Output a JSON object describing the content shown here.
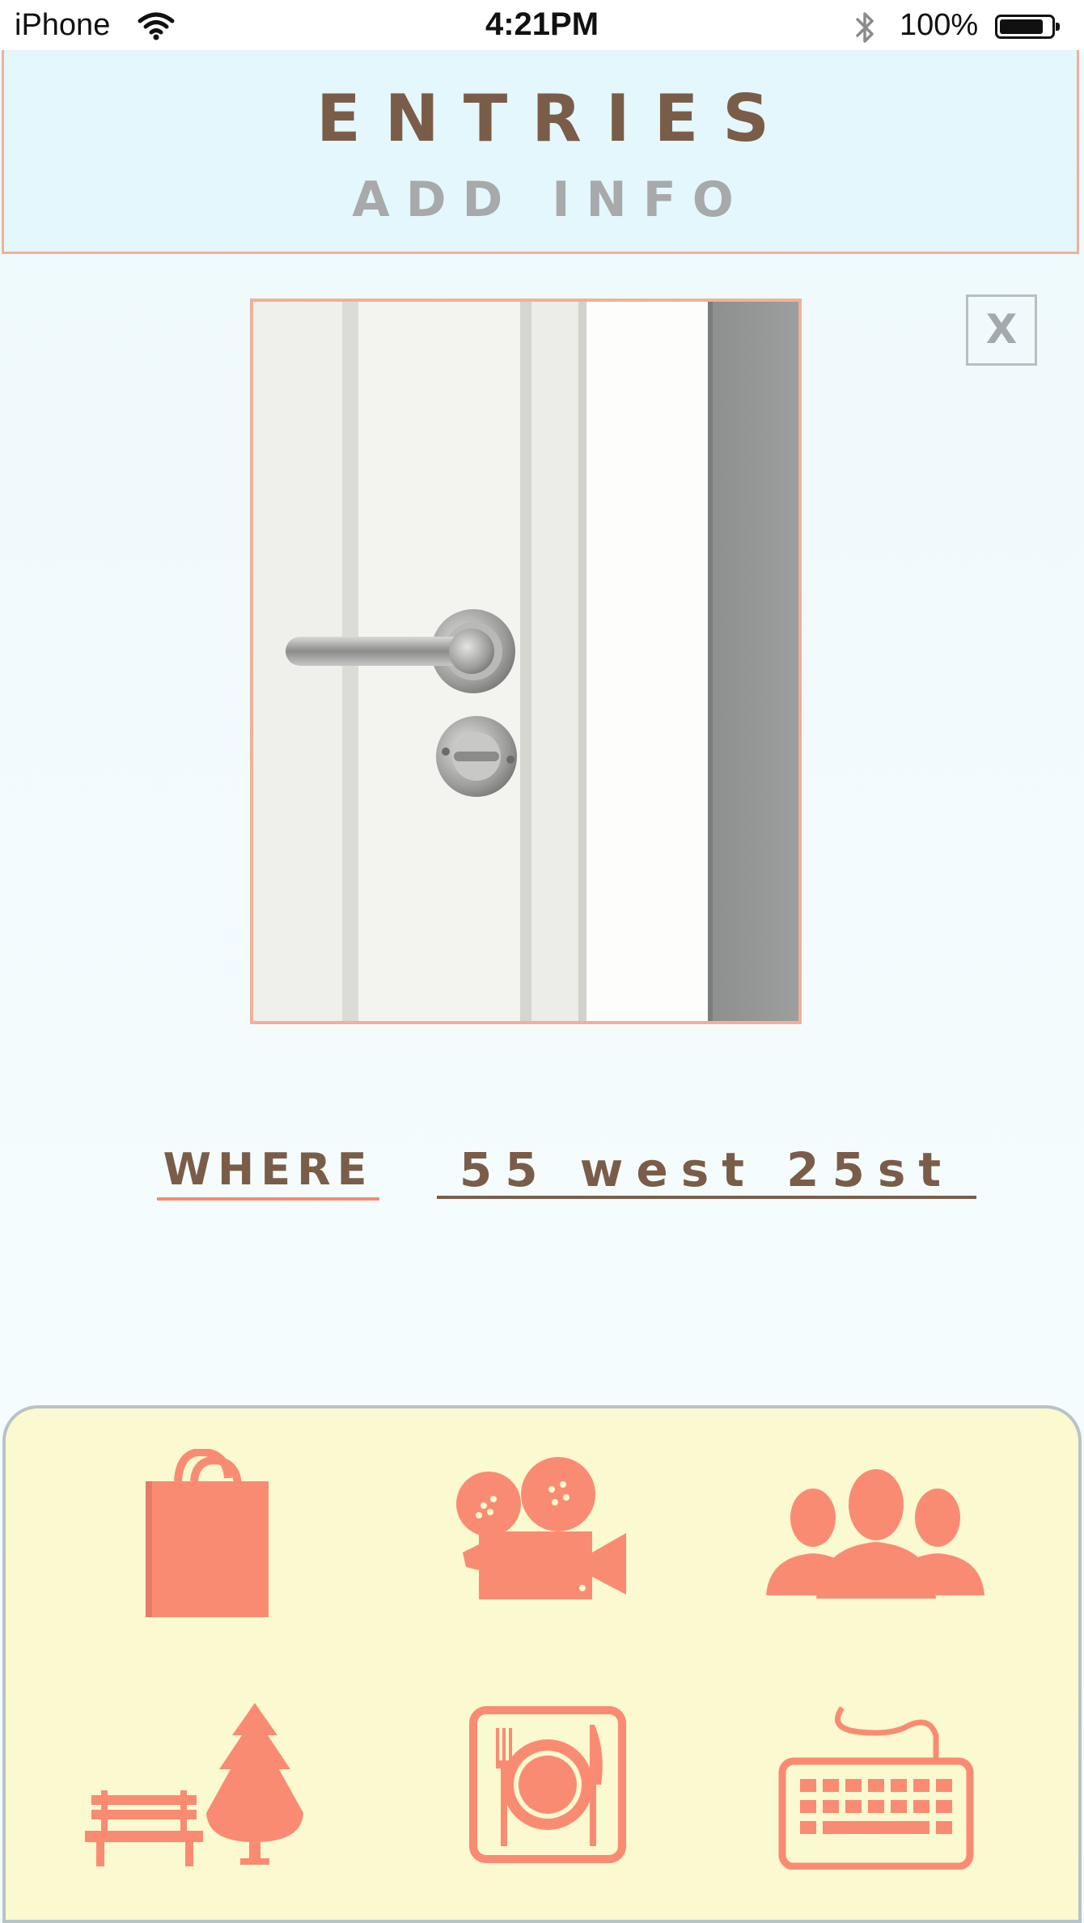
{
  "status_bar": {
    "carrier": "iPhone",
    "time": "4:21PM",
    "battery_percent_label": "100%",
    "battery_level": 0.85,
    "icons": [
      "wifi-icon",
      "bluetooth-icon",
      "battery-icon"
    ]
  },
  "header": {
    "title": "ENTRIES",
    "subtitle": "ADD INFO"
  },
  "close_button": {
    "label": "X"
  },
  "photo": {
    "subject": "door-handle-photo"
  },
  "where": {
    "label": "WHERE",
    "value": "55 west 25st"
  },
  "categories": [
    {
      "icon": "shopping-bag-icon"
    },
    {
      "icon": "movie-camera-icon"
    },
    {
      "icon": "people-group-icon"
    },
    {
      "icon": "park-bench-tree-icon"
    },
    {
      "icon": "plate-fork-knife-icon"
    },
    {
      "icon": "keyboard-icon"
    }
  ],
  "colors": {
    "accent": "#fa8b73",
    "brown": "#7a5d48",
    "header_bg": "#e3f7fc",
    "panel_bg": "#faf9cf",
    "border_peach": "#f0b09a"
  }
}
